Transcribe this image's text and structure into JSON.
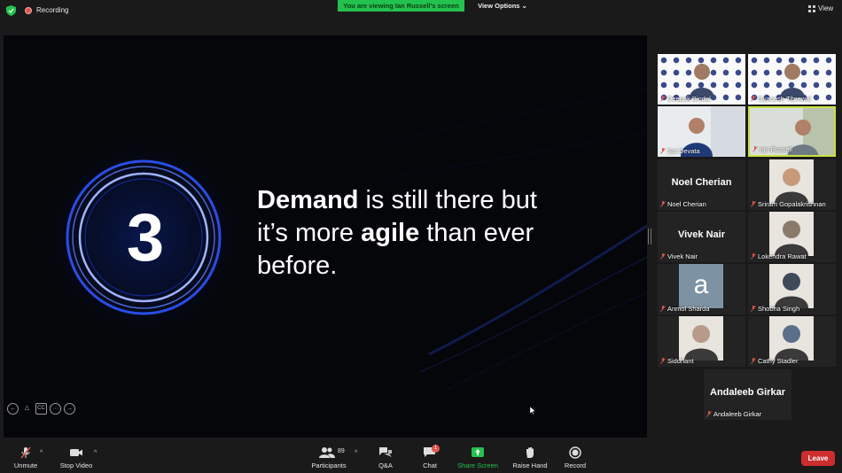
{
  "topbar": {
    "recording_label": "Recording",
    "viewing_banner": "You are viewing Ian Russell's screen",
    "view_options_label": "View Options",
    "view_label": "View"
  },
  "slide": {
    "number": "3",
    "line1_bold": "Demand",
    "line1_rest": " is still there but",
    "line2_start": "it’s more ",
    "line2_bold": "agile",
    "line2_rest": " than ever",
    "line3": "before."
  },
  "participants": [
    {
      "name": "Deepak Bindal",
      "type": "video-logo"
    },
    {
      "name": "Gyanesh Tibrewal",
      "type": "video-logo"
    },
    {
      "name": "Sai Devata",
      "type": "video"
    },
    {
      "name": "Ian Russell",
      "type": "video",
      "active": true
    },
    {
      "name": "Noel Cherian",
      "type": "name",
      "display": "Noel Cherian"
    },
    {
      "name": "Sriram Gopalakrishnan",
      "type": "photo"
    },
    {
      "name": "Vivek Nair",
      "type": "name",
      "display": "Vivek Nair"
    },
    {
      "name": "Lokendra Rawat",
      "type": "photo"
    },
    {
      "name": "Anmol Sharda",
      "type": "avatar",
      "initial": "a"
    },
    {
      "name": "Shobha Singh",
      "type": "photo"
    },
    {
      "name": "Siddhant",
      "type": "photo"
    },
    {
      "name": "Cathy Stadler",
      "type": "photo"
    },
    {
      "name": "Andaleeb Girkar",
      "type": "name",
      "display": "Andaleeb Girkar"
    }
  ],
  "toolbar": {
    "unmute": "Unmute",
    "stop_video": "Stop Video",
    "participants": "Participants",
    "participants_count": "89",
    "qa": "Q&A",
    "chat": "Chat",
    "chat_badge": "1",
    "share_screen": "Share Screen",
    "raise_hand": "Raise Hand",
    "record": "Record",
    "leave": "Leave"
  },
  "colors": {
    "banner_green": "#23c14d",
    "active_tile_border": "#c9e23e",
    "leave_red": "#cc2d2d",
    "share_green": "#23c14d"
  }
}
